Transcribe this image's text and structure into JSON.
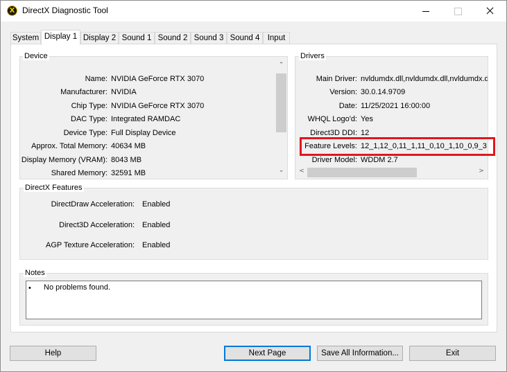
{
  "window": {
    "title": "DirectX Diagnostic Tool"
  },
  "tabs": [
    {
      "label": "System"
    },
    {
      "label": "Display 1"
    },
    {
      "label": "Display 2"
    },
    {
      "label": "Sound 1"
    },
    {
      "label": "Sound 2"
    },
    {
      "label": "Sound 3"
    },
    {
      "label": "Sound 4"
    },
    {
      "label": "Input"
    }
  ],
  "device": {
    "title": "Device",
    "rows": [
      {
        "label": "Name:",
        "value": "NVIDIA GeForce RTX 3070"
      },
      {
        "label": "Manufacturer:",
        "value": "NVIDIA"
      },
      {
        "label": "Chip Type:",
        "value": "NVIDIA GeForce RTX 3070"
      },
      {
        "label": "DAC Type:",
        "value": "Integrated RAMDAC"
      },
      {
        "label": "Device Type:",
        "value": "Full Display Device"
      },
      {
        "label": "Approx. Total Memory:",
        "value": "40634 MB"
      },
      {
        "label": "Display Memory (VRAM):",
        "value": "8043 MB"
      },
      {
        "label": "Shared Memory:",
        "value": "32591 MB"
      }
    ]
  },
  "drivers": {
    "title": "Drivers",
    "rows": [
      {
        "label": "Main Driver:",
        "value": "nvldumdx.dll,nvldumdx.dll,nvldumdx.dll,nvldumdx.d"
      },
      {
        "label": "Version:",
        "value": "30.0.14.9709"
      },
      {
        "label": "Date:",
        "value": "11/25/2021 16:00:00"
      },
      {
        "label": "WHQL Logo'd:",
        "value": "Yes"
      },
      {
        "label": "Direct3D DDI:",
        "value": "12"
      },
      {
        "label": "Feature Levels:",
        "value": "12_1,12_0,11_1,11_0,10_1,10_0,9_3"
      },
      {
        "label": "Driver Model:",
        "value": "WDDM 2.7"
      }
    ]
  },
  "features": {
    "title": "DirectX Features",
    "rows": [
      {
        "label": "DirectDraw Acceleration:",
        "value": "Enabled"
      },
      {
        "label": "Direct3D Acceleration:",
        "value": "Enabled"
      },
      {
        "label": "AGP Texture Acceleration:",
        "value": "Enabled"
      }
    ]
  },
  "notes": {
    "title": "Notes",
    "bullet": "•",
    "items": [
      "No problems found."
    ]
  },
  "buttons": {
    "help": "Help",
    "next_page": "Next Page",
    "save_all": "Save All Information...",
    "exit": "Exit"
  },
  "colors": {
    "highlight": "#e0161f",
    "default_button_border": "#0078d7"
  }
}
